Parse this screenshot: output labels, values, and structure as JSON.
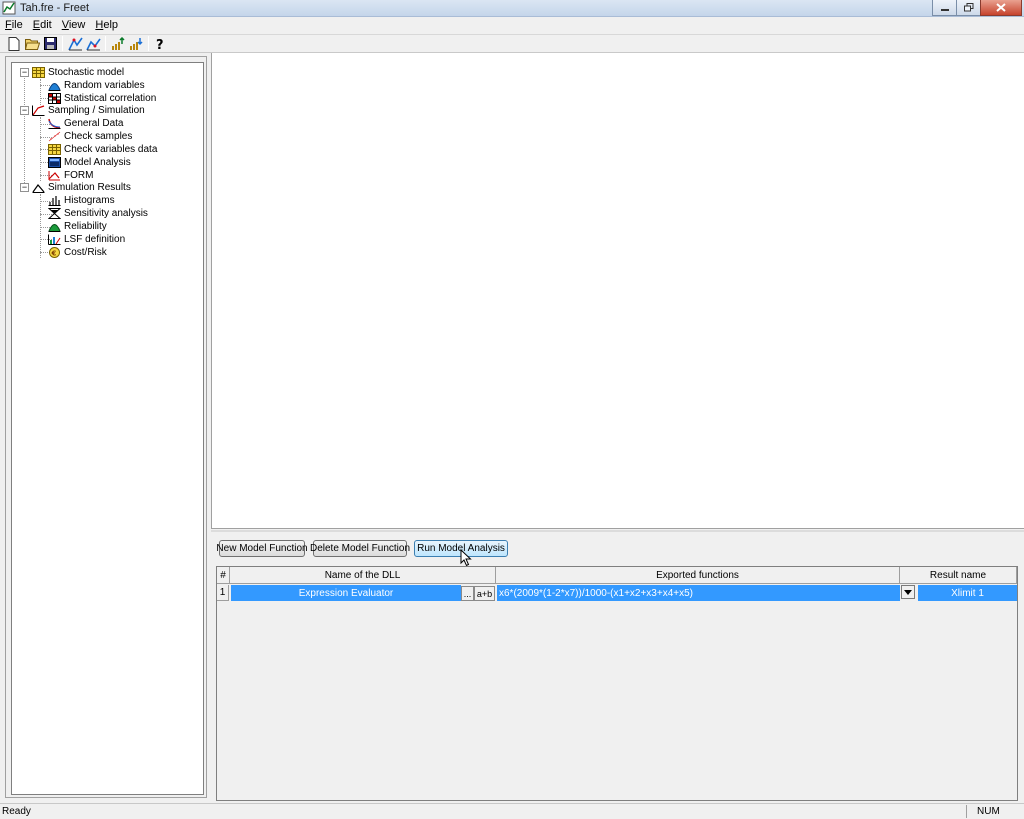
{
  "window": {
    "title": "Tah.fre - Freet"
  },
  "menu": [
    {
      "key": "F",
      "rest": "ile"
    },
    {
      "key": "E",
      "rest": "dit"
    },
    {
      "key": "V",
      "rest": "iew"
    },
    {
      "key": "H",
      "rest": "elp"
    }
  ],
  "toolbar": {
    "icons": [
      "new-file-icon",
      "open-folder-icon",
      "save-icon",
      "sampling-icon",
      "simulation-icon",
      "chart-up-icon",
      "chart-down-icon",
      "help-icon"
    ]
  },
  "tree": {
    "stochastic_model": "Stochastic model",
    "random_variables": "Random variables",
    "statistical_correlation": "Statistical correlation",
    "sampling_simulation": "Sampling / Simulation",
    "general_data": "General Data",
    "check_samples": "Check samples",
    "check_variables_data": "Check variables data",
    "model_analysis": "Model Analysis",
    "form": "FORM",
    "simulation_results": "Simulation Results",
    "histograms": "Histograms",
    "sensitivity_analysis": "Sensitivity analysis",
    "reliability": "Reliability",
    "lsf_definition": "LSF definition",
    "cost_risk": "Cost/Risk"
  },
  "buttons": {
    "new_model_function": "New Model Function",
    "delete_model_function": "Delete Model Function",
    "run_model_analysis": "Run Model Analysis"
  },
  "grid": {
    "headers": {
      "num": "#",
      "dll": "Name of the DLL",
      "functions": "Exported functions",
      "result": "Result name"
    },
    "rows": [
      {
        "num": "1",
        "dll": "Expression Evaluator",
        "browse": "...",
        "expr_btn": "a+b",
        "function": "x6*(2009*(1-2*x7))/1000-(x1+x2+x3+x4+x5)",
        "result": "Xlimit 1"
      }
    ]
  },
  "status": {
    "text": "Ready",
    "num": "NUM"
  },
  "colors": {
    "selection": "#3399ff",
    "titlebar": "#c4d5ea"
  }
}
